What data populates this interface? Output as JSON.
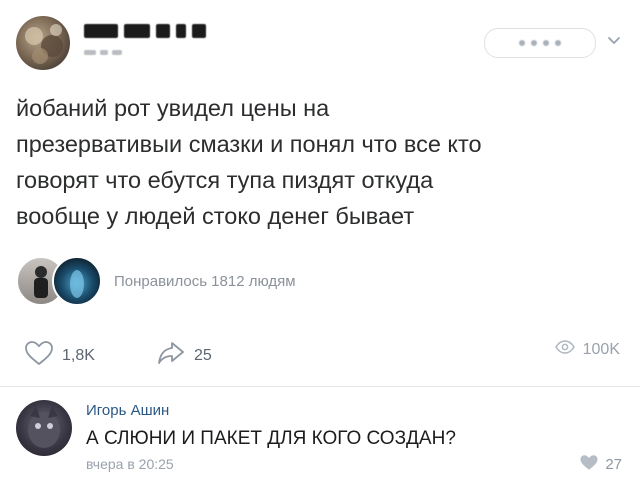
{
  "post": {
    "lines": [
      "йобаний рот увидел цены на",
      "презервативыи смазки и понял что все кто",
      "говорят что ебутся тупа пиздят откуда",
      "вообще у людей стоко денег бывает"
    ],
    "liked_by_text": "Понравилось 1812 людям"
  },
  "actions": {
    "likes": "1,8K",
    "shares": "25",
    "views": "100K"
  },
  "comment": {
    "author": "Игорь Ашин",
    "text": "А СЛЮНИ И ПАКЕТ ДЛЯ КОГО СОЗДАН?",
    "time": "вчера в 20:25",
    "likes": "27"
  },
  "colors": {
    "link": "#2a5885",
    "muted": "#9aa2ab",
    "text": "#2c2d2e"
  },
  "icons": {
    "like": "heart-icon",
    "share": "share-icon",
    "views": "eye-icon",
    "menu": "chevron-down-icon"
  }
}
